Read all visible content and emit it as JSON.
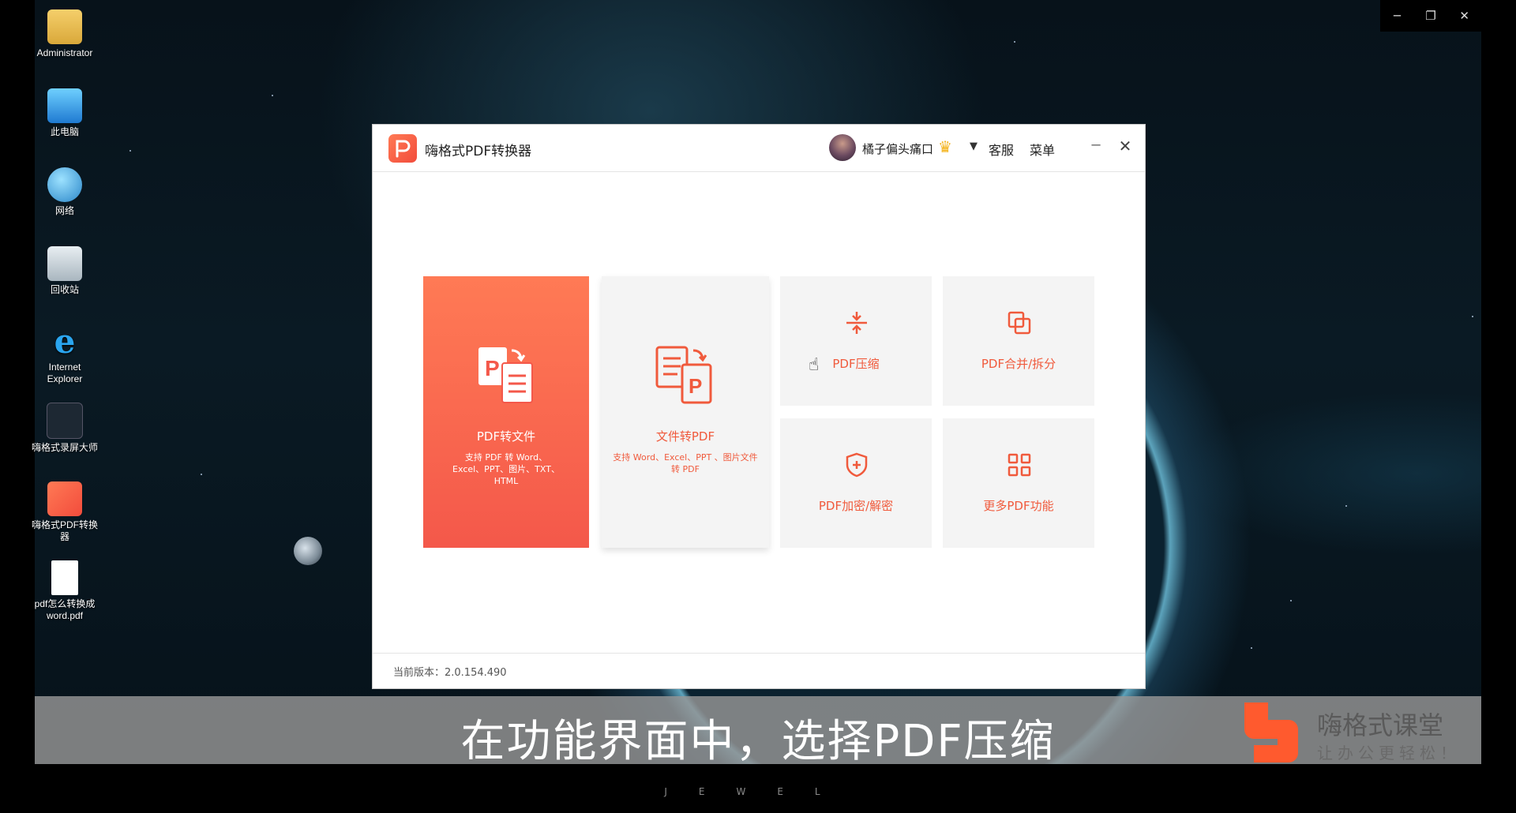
{
  "desktop": {
    "icons": [
      {
        "label": "Administrator",
        "icon": "user-folder-icon"
      },
      {
        "label": "此电脑",
        "icon": "computer-icon"
      },
      {
        "label": "网络",
        "icon": "network-icon"
      },
      {
        "label": "回收站",
        "icon": "recycle-bin-icon"
      },
      {
        "label": "Internet Explorer",
        "icon": "internet-explorer-icon"
      },
      {
        "label": "嗨格式录屏大师",
        "icon": "screen-recorder-icon"
      },
      {
        "label": "嗨格式PDF转换器",
        "icon": "pdf-converter-icon"
      },
      {
        "label": "pdf怎么转换成word.pdf",
        "icon": "pdf-file-icon"
      }
    ]
  },
  "window_controls": {
    "minimize": "─",
    "restore": "❐",
    "close": "✕"
  },
  "app": {
    "title": "嗨格式PDF转换器",
    "user_name": "橘子偏头痛口",
    "customer_service": "客服",
    "menu": "菜单",
    "minimize": "─",
    "close": "✕",
    "tiles": {
      "pdf_to_file": {
        "label": "PDF转文件",
        "desc": "支持 PDF 转 Word、Excel、PPT、图片、TXT、HTML"
      },
      "file_to_pdf": {
        "label": "文件转PDF",
        "desc": "支持 Word、Excel、PPT 、图片文件转 PDF"
      },
      "pdf_compress": {
        "label": "PDF压缩"
      },
      "pdf_merge_split": {
        "label": "PDF合并/拆分"
      },
      "pdf_encrypt": {
        "label": "PDF加密/解密"
      },
      "more": {
        "label": "更多PDF功能"
      }
    },
    "version": "当前版本：2.0.154.490"
  },
  "banner": {
    "subtitle": "在功能界面中，选择PDF压缩",
    "brand_name": "嗨格式课堂",
    "slogan": "让办公更轻松！"
  },
  "bottom_text": "JEWEL",
  "colors": {
    "accent": "#f05a3c",
    "tile_bg": "#f4f4f4"
  }
}
